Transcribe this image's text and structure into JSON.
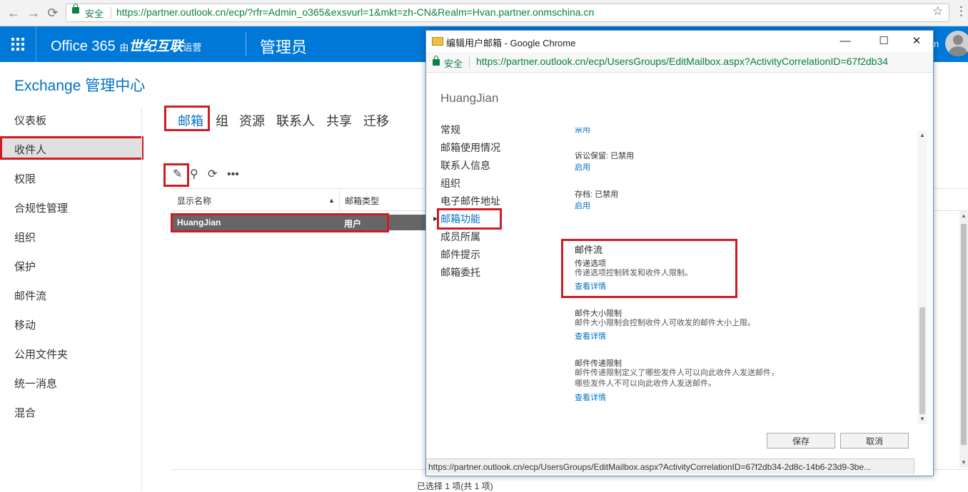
{
  "browser": {
    "secure_label": "安全",
    "url": "https://partner.outlook.cn/ecp/?rfr=Admin_o365&exsvurl=1&mkt=zh-CN&Realm=Hvan.partner.onmschina.cn"
  },
  "header": {
    "brand": "Office 365",
    "brand_you": "由",
    "brand_company": "世纪互联",
    "brand_operate": "运营",
    "admin_title": "管理员",
    "user_initial": "n"
  },
  "eac": {
    "title": "Exchange 管理中心",
    "nav": [
      "仪表板",
      "收件人",
      "权限",
      "合规性管理",
      "组织",
      "保护",
      "邮件流",
      "移动",
      "公用文件夹",
      "统一消息",
      "混合"
    ]
  },
  "tabs": [
    "邮箱",
    "组",
    "资源",
    "联系人",
    "共享",
    "迁移"
  ],
  "list": {
    "col_display_name": "显示名称",
    "col_mailbox_type": "邮箱类型",
    "rows": [
      {
        "name": "HuangJian",
        "type": "用户"
      }
    ],
    "selection_status": "已选择 1 项(共 1 项)"
  },
  "popup": {
    "title": "编辑用户邮箱 - Google Chrome",
    "secure_label": "安全",
    "url": "https://partner.outlook.cn/ecp/UsersGroups/EditMailbox.aspx?ActivityCorrelationID=67f2db34",
    "user_name": "HuangJian",
    "nav": [
      "常规",
      "邮箱使用情况",
      "联系人信息",
      "组织",
      "电子邮件地址",
      "邮箱功能",
      "成员所属",
      "邮件提示",
      "邮箱委托"
    ],
    "partial_top_link": "禁用",
    "litigation_hold": "诉讼保留: 已禁用",
    "litigation_link": "启用",
    "archive": "存档: 已禁用",
    "archive_link": "启用",
    "mail_flow_title": "邮件流",
    "delivery_options_title": "传递选项",
    "delivery_options_desc": "传递选项控制转发和收件人限制。",
    "view_details": "查看详情",
    "size_limit_title": "邮件大小限制",
    "size_limit_desc": "邮件大小限制会控制收件人可收发的邮件大小上限。",
    "delivery_restrictions_title": "邮件传递限制",
    "delivery_restrictions_desc": "邮件传递限制定义了哪些发件人可以向此收件人发送邮件，哪些发件人不可以向此收件人发送邮件。",
    "save_label": "保存",
    "cancel_label": "取消",
    "status_url": "https://partner.outlook.cn/ecp/UsersGroups/EditMailbox.aspx?ActivityCorrelationID=67f2db34-2d8c-14b6-23d9-3be..."
  },
  "colors": {
    "accent": "#0078d7",
    "link": "#0072c6",
    "highlight_box": "#d11b24"
  }
}
